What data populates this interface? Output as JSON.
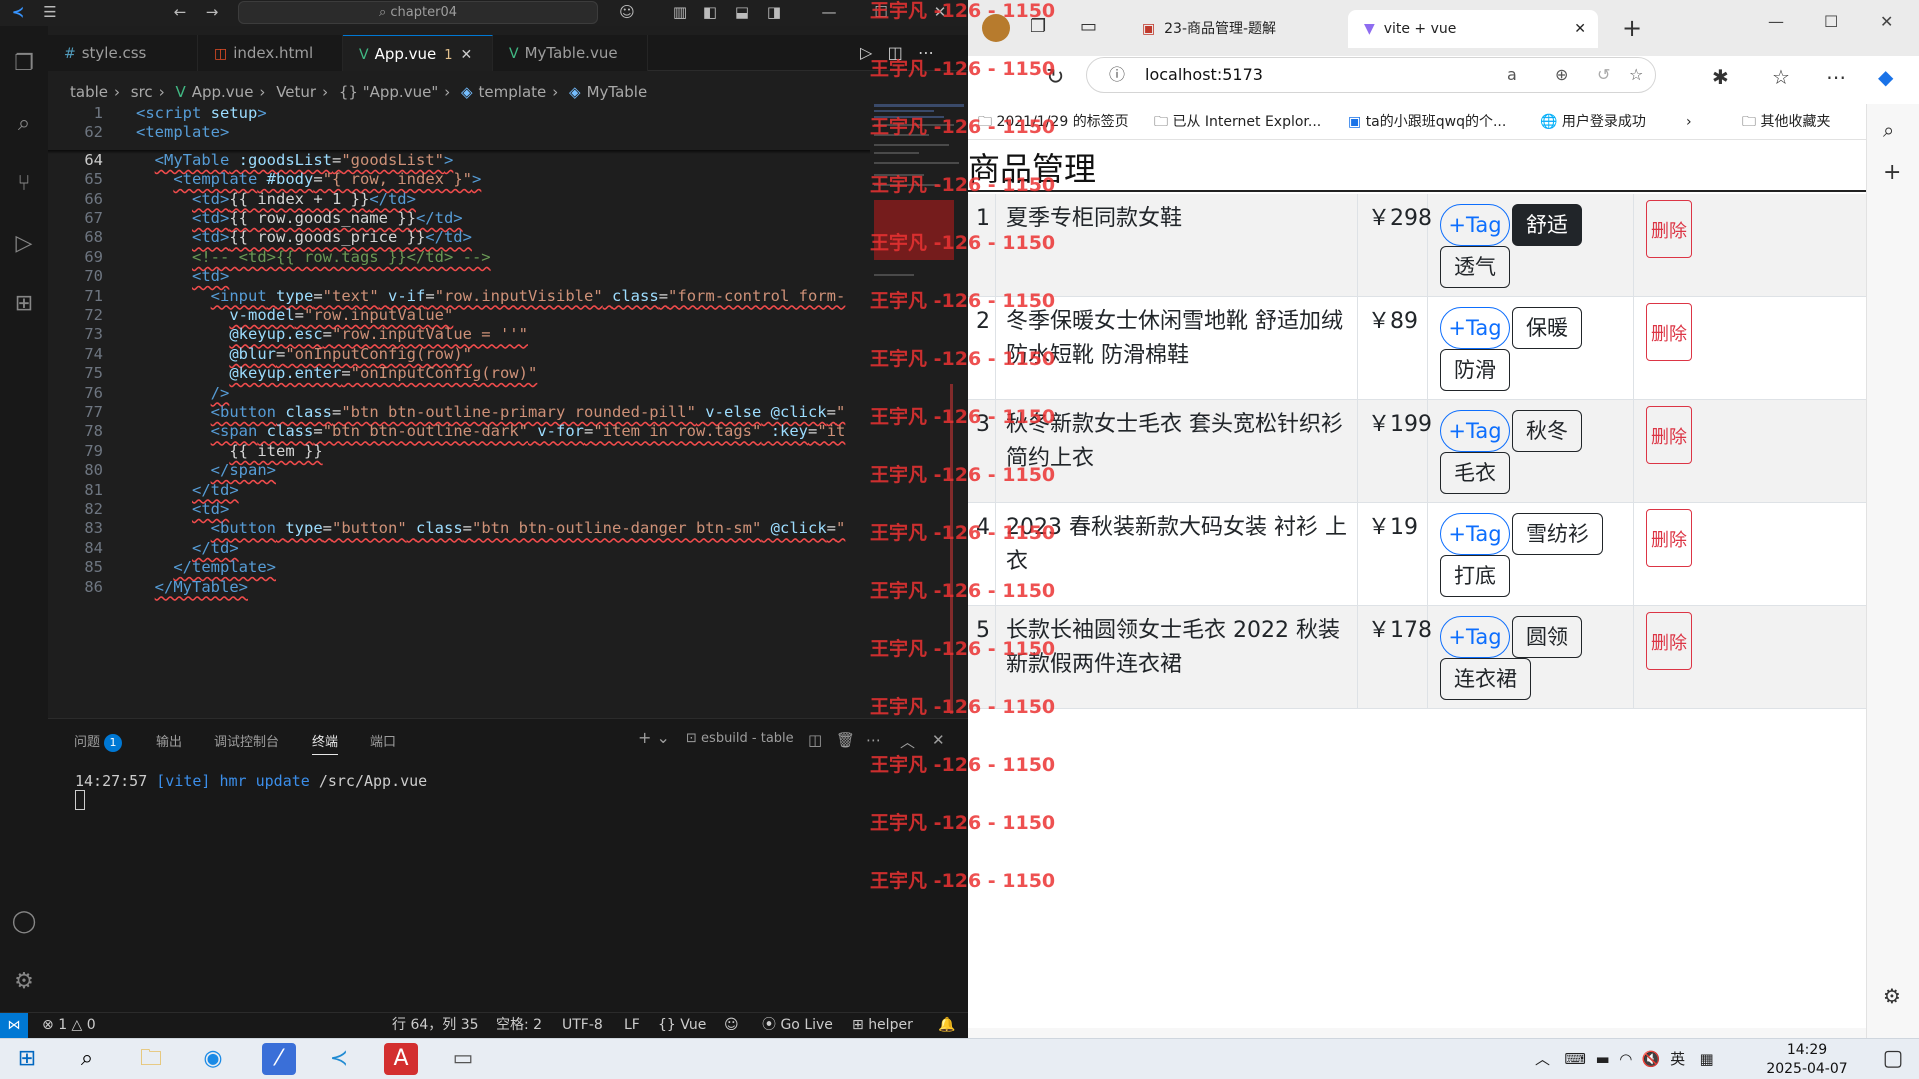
{
  "vscode": {
    "title_search": "chapter04",
    "tabs": [
      {
        "label": "style.css",
        "icon": "css-file-icon",
        "active": false
      },
      {
        "label": "index.html",
        "icon": "html-file-icon",
        "active": false
      },
      {
        "label": "App.vue",
        "icon": "vue-file-icon",
        "active": true,
        "problems": "1"
      },
      {
        "label": "MyTable.vue",
        "icon": "vue-file-icon",
        "active": false
      }
    ],
    "breadcrumb": [
      "table",
      "src",
      "App.vue",
      "Vetur",
      "{} \"App.vue\"",
      "template",
      "MyTable"
    ],
    "lines": [
      {
        "n": "1",
        "html": "<span class=\"tag\">&lt;script</span> <span class=\"attr\">setup</span><span class=\"tag\">&gt;</span>"
      },
      {
        "n": "62",
        "html": "<span class=\"tag\">&lt;template&gt;</span>"
      },
      {
        "n": "64",
        "html": "  <span class=\"tag err\">&lt;MyTable</span><span class=\"err\"> <span class=\"attr\">:goodsList</span>=<span class=\"str\">\"goodsList\"</span></span><span class=\"tag err\">&gt;</span>"
      },
      {
        "n": "65",
        "html": "    <span class=\"tag err\">&lt;template</span><span class=\"err\"> <span class=\"attr\">#body</span>=<span class=\"str\">\"{ row, index }\"</span></span><span class=\"tag err\">&gt;</span>"
      },
      {
        "n": "66",
        "html": "      <span class=\"tag err\">&lt;td&gt;</span><span class=\"mus err\">{{ index + 1 }}</span><span class=\"tag err\">&lt;/td&gt;</span>"
      },
      {
        "n": "67",
        "html": "      <span class=\"tag err\">&lt;td&gt;</span><span class=\"mus err\">{{ row.goods_name }}</span><span class=\"tag err\">&lt;/td&gt;</span>"
      },
      {
        "n": "68",
        "html": "      <span class=\"tag err\">&lt;td&gt;</span><span class=\"mus err\">{{ row.goods_price }}</span><span class=\"tag err\">&lt;/td&gt;</span>"
      },
      {
        "n": "69",
        "html": "      <span class=\"cmt err\">&lt;!-- &lt;td&gt;{{ row.tags }}&lt;/td&gt; --&gt;</span>"
      },
      {
        "n": "70",
        "html": "      <span class=\"tag err\">&lt;td&gt;</span>"
      },
      {
        "n": "71",
        "html": "        <span class=\"tag err\">&lt;input</span><span class=\"err\"> <span class=\"attr\">type</span>=<span class=\"str\">\"text\"</span> <span class=\"attr\">v-if</span>=<span class=\"str\">\"row.inputVisible\"</span> <span class=\"attr\">class</span>=<span class=\"str\">\"form-control form-</span></span>"
      },
      {
        "n": "72",
        "html": "          <span class=\"attr err\">v-model</span><span class=\"err\">=<span class=\"str\">\"row.inputValue\"</span></span>"
      },
      {
        "n": "73",
        "html": "          <span class=\"attr err\">@keyup.esc</span><span class=\"err\">=<span class=\"str\">\"row.inputValue = ''\"</span></span>"
      },
      {
        "n": "74",
        "html": "          <span class=\"attr err\">@blur</span><span class=\"err\">=<span class=\"str\">\"onInputConfig(row)\"</span></span>"
      },
      {
        "n": "75",
        "html": "          <span class=\"attr err\">@keyup.enter</span><span class=\"err\">=<span class=\"str\">\"onInputConfig(row)\"</span></span>"
      },
      {
        "n": "76",
        "html": "        <span class=\"tag err\">/&gt;</span>"
      },
      {
        "n": "77",
        "html": "        <span class=\"tag err\">&lt;button</span><span class=\"err\"> <span class=\"attr\">class</span>=<span class=\"str\">\"btn btn-outline-primary rounded-pill\"</span> <span class=\"attr\">v-else</span> <span class=\"attr\">@click</span>=<span class=\"str\">\"</span></span>"
      },
      {
        "n": "78",
        "html": "        <span class=\"tag err\">&lt;span</span><span class=\"err\"> <span class=\"attr\">class</span>=<span class=\"str\">\"btn btn-outline-dark\"</span> <span class=\"attr\">v-for</span>=<span class=\"str\">\"item in row.tags\"</span> <span class=\"attr\">:key</span>=<span class=\"str\">\"it</span></span>"
      },
      {
        "n": "79",
        "html": "          <span class=\"mus err\">{{ item }}</span>"
      },
      {
        "n": "80",
        "html": "        <span class=\"tag err\">&lt;/span&gt;</span>"
      },
      {
        "n": "81",
        "html": "      <span class=\"tag err\">&lt;/td&gt;</span>"
      },
      {
        "n": "82",
        "html": "      <span class=\"tag err\">&lt;td&gt;</span>"
      },
      {
        "n": "83",
        "html": "        <span class=\"tag err\">&lt;button</span><span class=\"err\"> <span class=\"attr\">type</span>=<span class=\"str\">\"button\"</span> <span class=\"attr\">class</span>=<span class=\"str\">\"btn btn-outline-danger btn-sm\"</span> <span class=\"attr\">@click</span>=<span class=\"str\">\"</span></span>"
      },
      {
        "n": "84",
        "html": "      <span class=\"tag err\">&lt;/td&gt;</span>"
      },
      {
        "n": "85",
        "html": "    <span class=\"tag err\">&lt;/template&gt;</span>"
      },
      {
        "n": "86",
        "html": "  <span class=\"tag err\">&lt;/MyTable&gt;</span>"
      }
    ],
    "current_line": "64",
    "panel_tabs": [
      {
        "label": "问题",
        "badge": "1"
      },
      {
        "label": "输出"
      },
      {
        "label": "调试控制台"
      },
      {
        "label": "终端",
        "active": true
      },
      {
        "label": "端口"
      }
    ],
    "terminal_name": "esbuild - table",
    "terminal_time": "14:27:57",
    "terminal_tag": "[vite]",
    "terminal_msg": "hmr update",
    "terminal_path": "/src/App.vue",
    "status": {
      "errors": "1",
      "warnings": "0",
      "position": "行 64，列 35",
      "spaces": "空格: 2",
      "encoding": "UTF-8",
      "eol": "LF",
      "language": "Vue",
      "golive": "Go Live",
      "helper": "helper"
    }
  },
  "browser": {
    "tabs": [
      {
        "label": "23-商品管理-题解"
      },
      {
        "label": "vite + vue",
        "active": true
      }
    ],
    "url": "localhost:5173",
    "bookmarks": [
      "2021/1/29 的标签页",
      "已从 Internet Explor...",
      "ta的小跟班qwq的个...",
      "用户登录成功",
      "其他收藏夹"
    ],
    "page_title": "商品管理",
    "add_tag_label": "+Tag",
    "delete_label": "删除",
    "goods": [
      {
        "id": "1",
        "name": "夏季专柜同款女鞋",
        "price": "￥298",
        "tags": [
          "舒适",
          "透气"
        ]
      },
      {
        "id": "2",
        "name": "冬季保暖女士休闲雪地靴 舒适加绒防水短靴 防滑棉鞋",
        "price": "￥89",
        "tags": [
          "保暖",
          "防滑"
        ]
      },
      {
        "id": "3",
        "name": "秋冬新款女士毛衣 套头宽松针织衫 简约上衣",
        "price": "￥199",
        "tags": [
          "秋冬",
          "毛衣"
        ]
      },
      {
        "id": "4",
        "name": "2023 春秋装新款大码女装 衬衫 上衣",
        "price": "￥19",
        "tags": [
          "雪纺衫",
          "打底"
        ]
      },
      {
        "id": "5",
        "name": "长款长袖圆领女士毛衣 2022 秋装新款假两件连衣裙",
        "price": "￥178",
        "tags": [
          "圆领",
          "连衣裙"
        ]
      }
    ]
  },
  "watermark": "王宇凡 -126 - 1150",
  "clock": {
    "time": "14:29",
    "date": "2025-04-07"
  },
  "tray_ime": "英",
  "colors": {
    "accent": "#0078d4",
    "primary": "#0d6efd",
    "danger": "#dc3545",
    "dark": "#212529"
  }
}
